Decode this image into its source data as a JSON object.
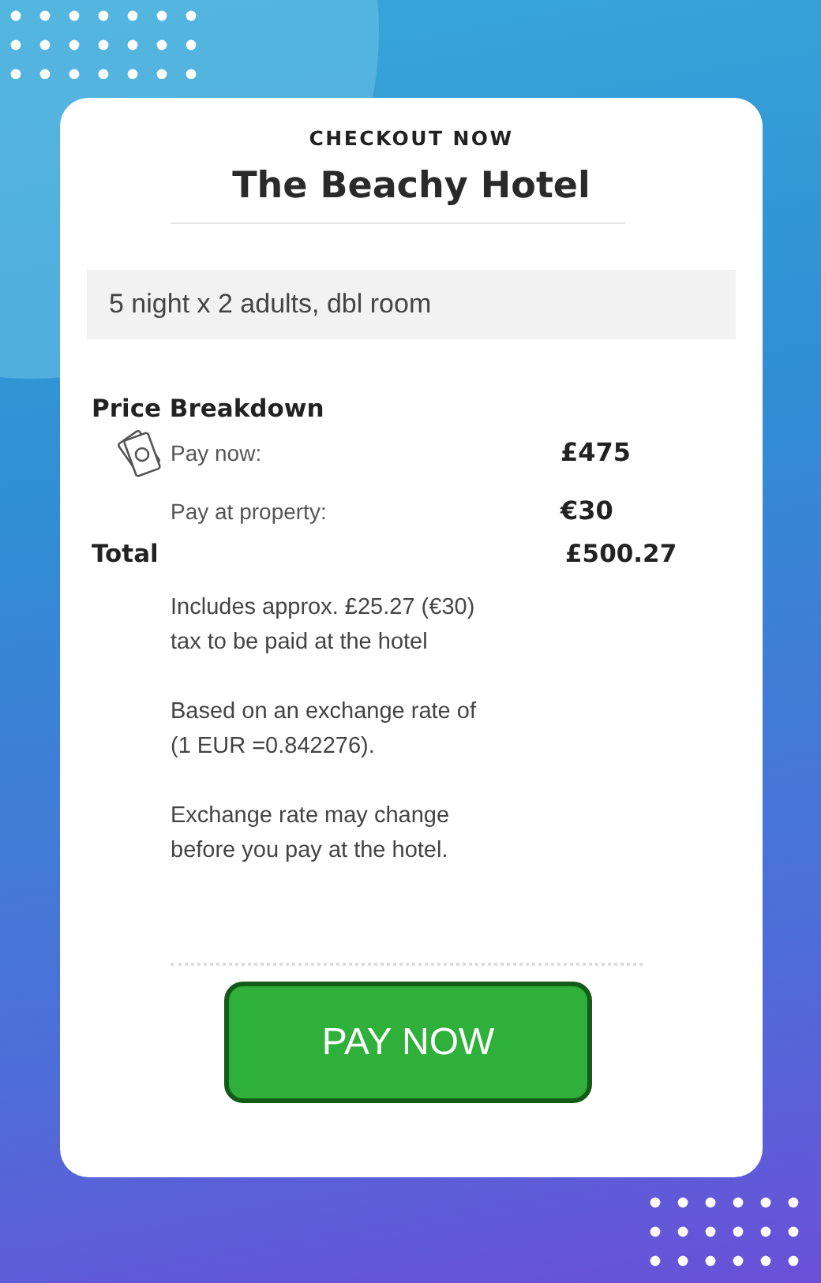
{
  "header": {
    "eyebrow": "CHECKOUT NOW",
    "title": "The Beachy Hotel"
  },
  "booking_summary": "5 night x 2 adults, dbl room",
  "price_breakdown": {
    "heading": "Price Breakdown",
    "rows": [
      {
        "label": "Pay now:",
        "value": "£475",
        "icon": true
      },
      {
        "label": "Pay at property:",
        "value": "€30",
        "icon": false
      }
    ],
    "total": {
      "label": "Total",
      "value": "£500.27"
    },
    "notes": [
      "Includes approx. £25.27 (€30) tax to be paid at the hotel",
      "Based on an exchange rate of (1 EUR =0.842276).",
      "Exchange rate may change before you pay at the hotel."
    ]
  },
  "button": "PAY NOW"
}
